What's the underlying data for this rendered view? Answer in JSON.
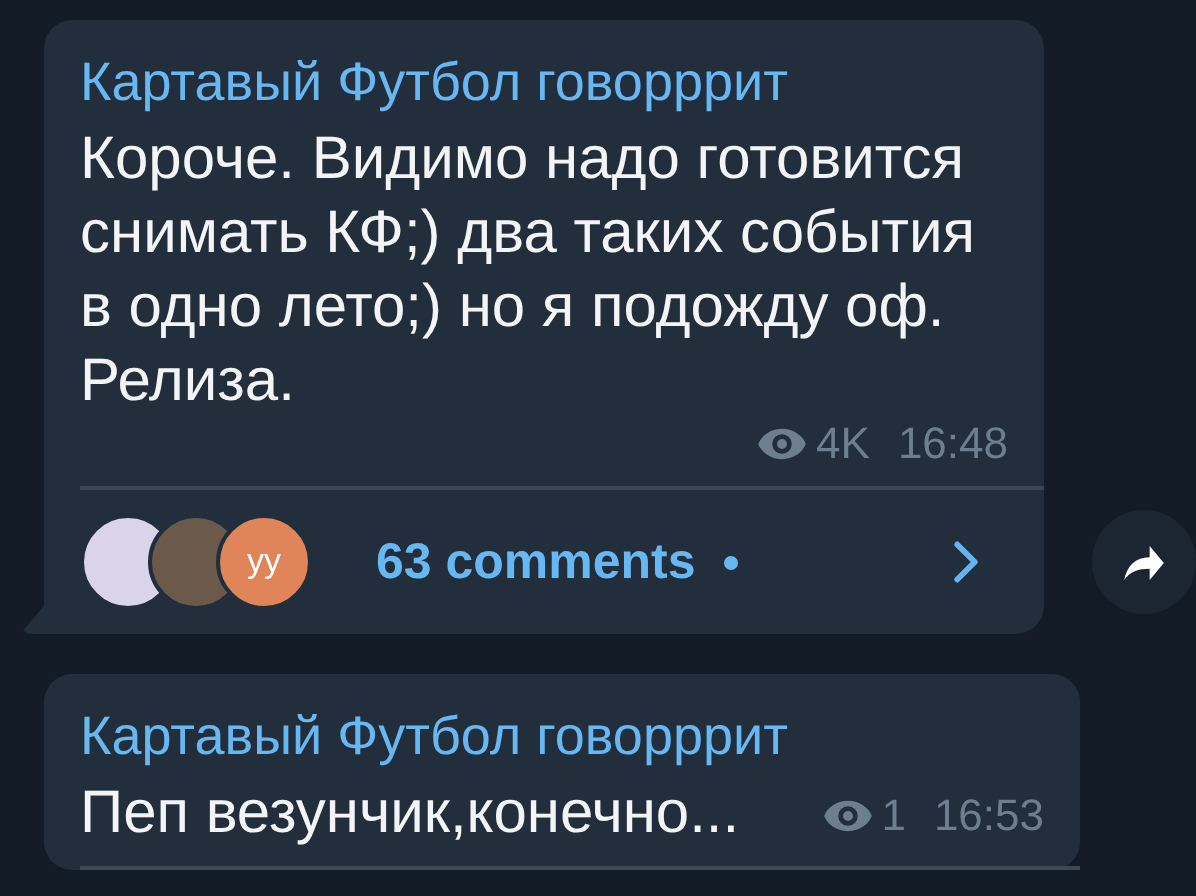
{
  "messages": [
    {
      "author": "Картавый Футбол говорррит",
      "text": "Короче. Видимо надо готовится снимать КФ;) два таких события в одно лето;) но я подожду оф. Релиза.",
      "views": "4K",
      "time": "16:48",
      "tail": true,
      "comments": {
        "label": "63 comments",
        "unread": true,
        "avatars": [
          {
            "kind": "photo"
          },
          {
            "kind": "photo"
          },
          {
            "kind": "initials",
            "initials": "уу",
            "color": "#e0845a"
          }
        ]
      }
    },
    {
      "author": "Картавый Футбол говорррит",
      "text": "Пеп везунчик,конечно...",
      "views": "1",
      "time": "16:53",
      "tail": false
    }
  ]
}
